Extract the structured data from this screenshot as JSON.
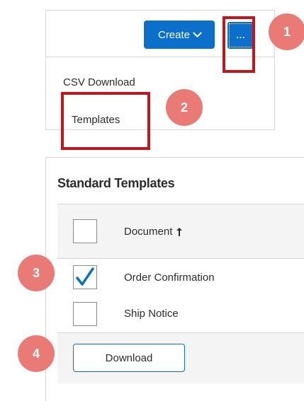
{
  "toolbar": {
    "create_label": "Create",
    "more_label": "...",
    "menu_items": [
      {
        "label": "CSV Download"
      },
      {
        "label": "Templates"
      }
    ]
  },
  "callouts": [
    "1",
    "2",
    "3",
    "4"
  ],
  "templates": {
    "title": "Standard Templates",
    "column_header": "Document",
    "rows": [
      {
        "label": "Order Confirmation",
        "checked": true
      },
      {
        "label": "Ship Notice",
        "checked": false
      }
    ],
    "download_label": "Download"
  },
  "colors": {
    "accent": "#0c6fc9",
    "highlight": "#c0161d",
    "callout": "#ea7a76"
  }
}
